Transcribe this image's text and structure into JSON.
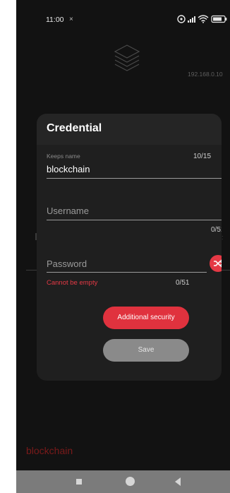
{
  "status_bar": {
    "time": "11:00",
    "x_mark": "×",
    "icons": [
      "alarm-icon",
      "signal-icon",
      "wifi-icon",
      "battery-icon"
    ]
  },
  "background": {
    "ip_address": "192.168.0.10",
    "title": "blockchain"
  },
  "dialog": {
    "title": "Credential",
    "keeps_name": {
      "label": "Keeps name",
      "value": "blockchain",
      "counter": "10/15"
    },
    "username": {
      "placeholder": "Username",
      "counter": "0/51"
    },
    "password": {
      "placeholder": "Password",
      "error": "Cannot be empty",
      "counter": "0/51"
    },
    "additional_security_button": "Additional security",
    "save_button": "Save"
  },
  "colors": {
    "accent": "#e53945",
    "dialog_bg": "#1f1f1f",
    "screen_bg": "#121212"
  }
}
